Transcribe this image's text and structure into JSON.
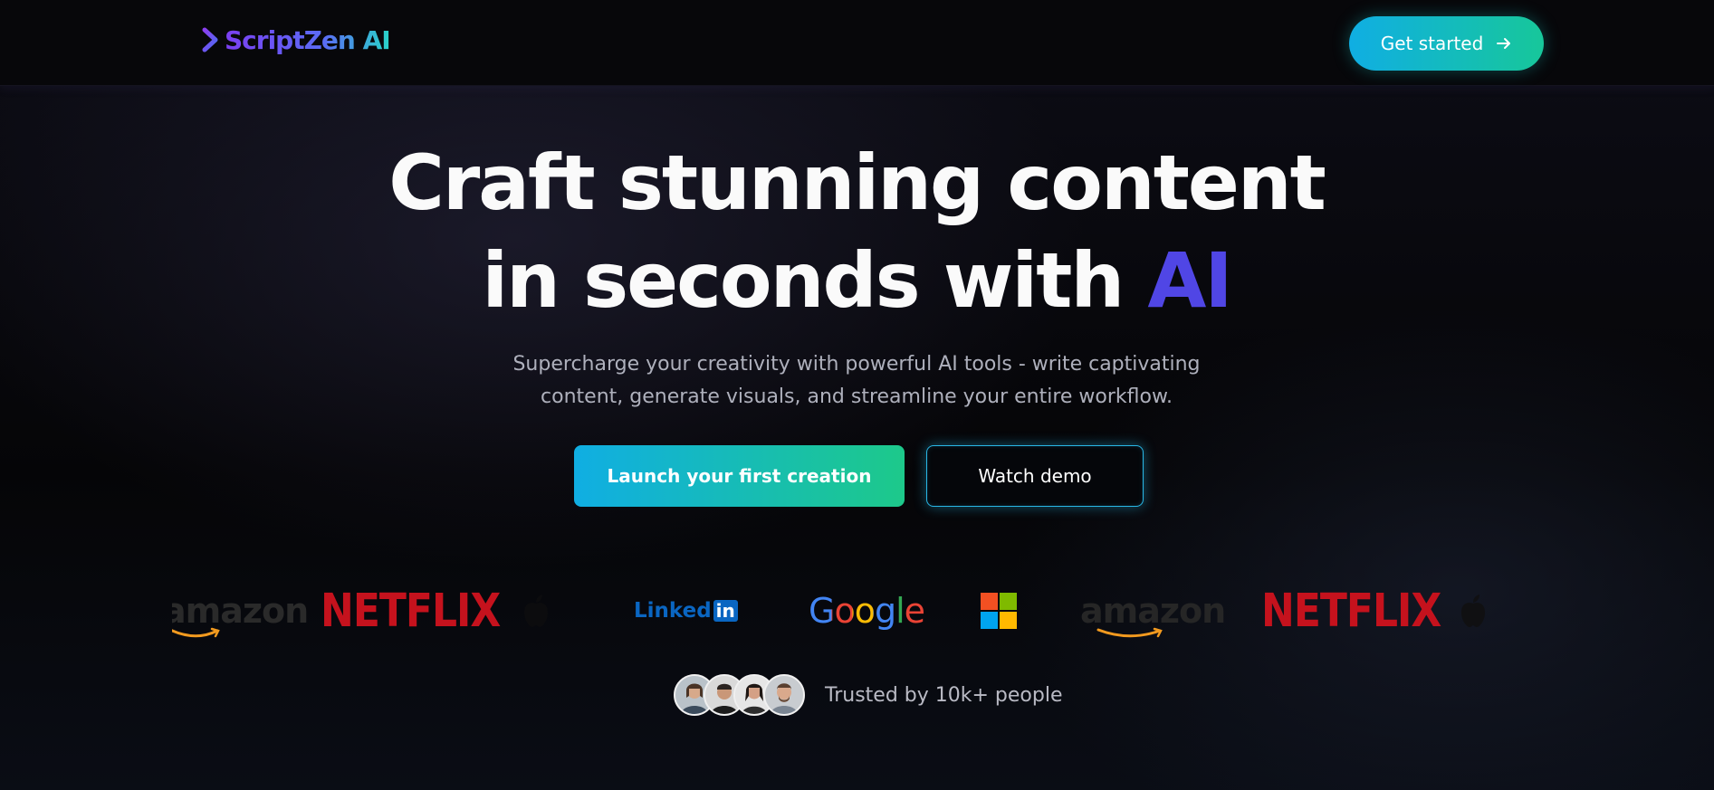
{
  "header": {
    "brand_name": "ScriptZen AI",
    "cta_label": "Get started"
  },
  "hero": {
    "title_line1": "Craft stunning content",
    "title_line2_prefix": "in seconds with ",
    "title_line2_accent": "AI",
    "subtitle_line1": "Supercharge your creativity with powerful AI tools - write captivating",
    "subtitle_line2": "content, generate visuals, and streamline your entire workflow.",
    "primary_button": "Launch your first creation",
    "secondary_button": "Watch demo"
  },
  "logos": {
    "items": [
      "amazon",
      "NETFLIX",
      "apple",
      "Linked",
      "in",
      "Google",
      "microsoft",
      "amazon",
      "NETFLIX",
      "apple"
    ]
  },
  "social_proof": {
    "text": "Trusted by 10k+ people"
  },
  "colors": {
    "accent": "#5046e5",
    "cta_gradient_start": "#10aee3",
    "cta_gradient_end": "#1dc98a",
    "netflix_red": "#c5121d"
  }
}
